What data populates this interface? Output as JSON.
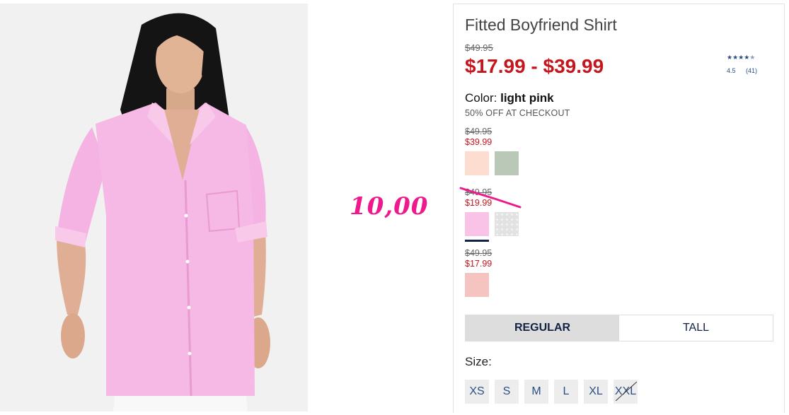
{
  "product": {
    "title": "Fitted Boyfriend Shirt",
    "original_price": "$49.95",
    "sale_range": "$17.99 - $39.99",
    "rating_value": "4.5",
    "rating_count": "(41)",
    "rating_stars": 4.5,
    "color_label": "Color:",
    "color_name": "light pink",
    "promo": "50% OFF AT CHECKOUT"
  },
  "price_groups": [
    {
      "was": "$49.95",
      "now": "$39.99",
      "swatches": [
        {
          "name": "peach",
          "color": "#fcddd0"
        },
        {
          "name": "sage",
          "color": "#b9c8b7"
        }
      ]
    },
    {
      "was": "$49.95",
      "now": "$19.99",
      "swatches": [
        {
          "name": "light pink",
          "color": "#f8c3e6",
          "selected": true
        },
        {
          "name": "grey dot",
          "pattern": "dots"
        }
      ]
    },
    {
      "was": "$49.95",
      "now": "$17.99",
      "swatches": [
        {
          "name": "blush",
          "color": "#f5c4c1"
        }
      ]
    }
  ],
  "annotation": {
    "text": "10,00",
    "color": "#ee1a8c"
  },
  "fit_tabs": [
    {
      "label": "REGULAR",
      "active": true
    },
    {
      "label": "TALL",
      "active": false
    }
  ],
  "size_label": "Size:",
  "sizes": [
    {
      "label": "XS",
      "available": true
    },
    {
      "label": "S",
      "available": true
    },
    {
      "label": "M",
      "available": true
    },
    {
      "label": "L",
      "available": true
    },
    {
      "label": "XL",
      "available": true
    },
    {
      "label": "XXL",
      "available": false
    }
  ],
  "colors": {
    "sale_red": "#c5161d",
    "navy": "#122344",
    "link_blue": "#2a4f86",
    "shirt_pink": "#f6b8e4"
  }
}
